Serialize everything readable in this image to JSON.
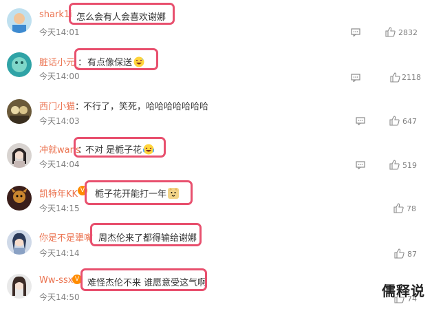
{
  "comments": [
    {
      "user": "shark1i",
      "text": "怎么会有人会喜欢谢娜",
      "time": "今天14:01",
      "likes": "2832",
      "highlight": true
    },
    {
      "user": "脏话小元_",
      "text": "有点像保送",
      "time": "今天14:00",
      "likes": "2118",
      "highlight": true,
      "emoji": "sweat-laugh-emoji"
    },
    {
      "user": "西门小猫",
      "text": "不行了，笑死，哈哈哈哈哈哈哈",
      "time": "今天14:03",
      "likes": "647",
      "highlight": false
    },
    {
      "user": "冲就wans",
      "text": "不对 是栀子花",
      "time": "今天14:04",
      "likes": "519",
      "highlight": true,
      "emoji": "laugh-cry-emoji"
    },
    {
      "user": "凯特年KK",
      "text": "栀子花开能打一年",
      "time": "今天14:15",
      "likes": "78",
      "highlight": true,
      "emoji": "doge-emoji"
    },
    {
      "user": "你是不是犟嘴",
      "text": "周杰伦来了都得输给谢娜",
      "time": "今天14:14",
      "likes": "87",
      "highlight": true
    },
    {
      "user": "Ww-ssx",
      "text": "难怪杰伦不来 谁愿意受这气啊",
      "time": "今天14:50",
      "likes": "74",
      "highlight": true
    }
  ],
  "watermark": "儒释说",
  "colors": {
    "username": "#eb7350",
    "highlight": "#e8506e",
    "meta": "#808080"
  }
}
